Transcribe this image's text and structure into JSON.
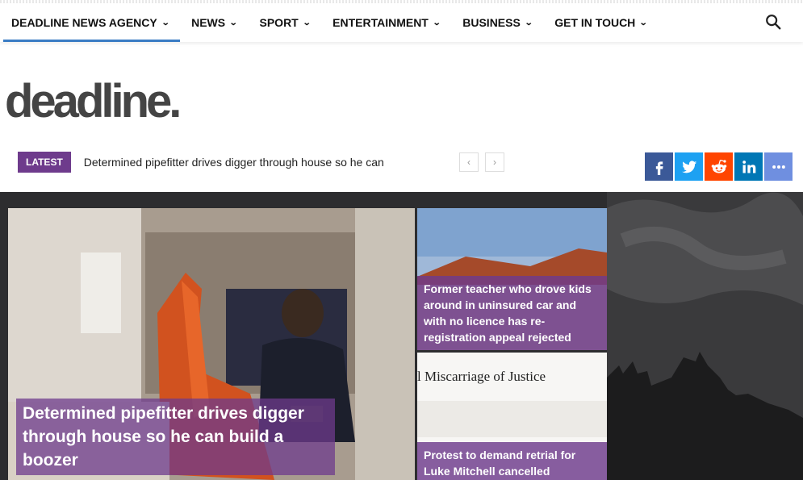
{
  "nav": {
    "items": [
      {
        "label": "DEADLINE NEWS AGENCY",
        "active": true
      },
      {
        "label": "NEWS",
        "active": false
      },
      {
        "label": "SPORT",
        "active": false
      },
      {
        "label": "ENTERTAINMENT",
        "active": false
      },
      {
        "label": "BUSINESS",
        "active": false
      },
      {
        "label": "GET IN TOUCH",
        "active": false
      }
    ],
    "search_icon": "search-icon"
  },
  "logo": {
    "text": "deadline."
  },
  "ticker": {
    "badge": "LATEST",
    "headline": "Determined pipefitter drives digger through house so he can",
    "prev": "‹",
    "next": "›"
  },
  "share": [
    {
      "name": "facebook-icon",
      "glyph": "f",
      "color": "#3b5998"
    },
    {
      "name": "twitter-icon",
      "glyph": "t",
      "color": "#1da1f2"
    },
    {
      "name": "reddit-icon",
      "glyph": "r",
      "color": "#ff4500"
    },
    {
      "name": "linkedin-icon",
      "glyph": "in",
      "color": "#0077b5"
    },
    {
      "name": "more-icon",
      "glyph": "•••",
      "color": "#6f8fe0"
    }
  ],
  "hero": {
    "main": {
      "title": "Determined pipefitter drives digger through house so he can build a boozer"
    },
    "side1": {
      "title": "Former teacher who drove kids around in uninsured car and with no licence has re-registration appeal rejected"
    },
    "side2": {
      "title": "Protest to demand retrial for Luke Mitchell cancelled following football fan carnage",
      "image_text": "l Miscarriage of Justice"
    }
  },
  "colors": {
    "accent": "#6e3b8c",
    "nav_active": "#3a7cc4"
  }
}
